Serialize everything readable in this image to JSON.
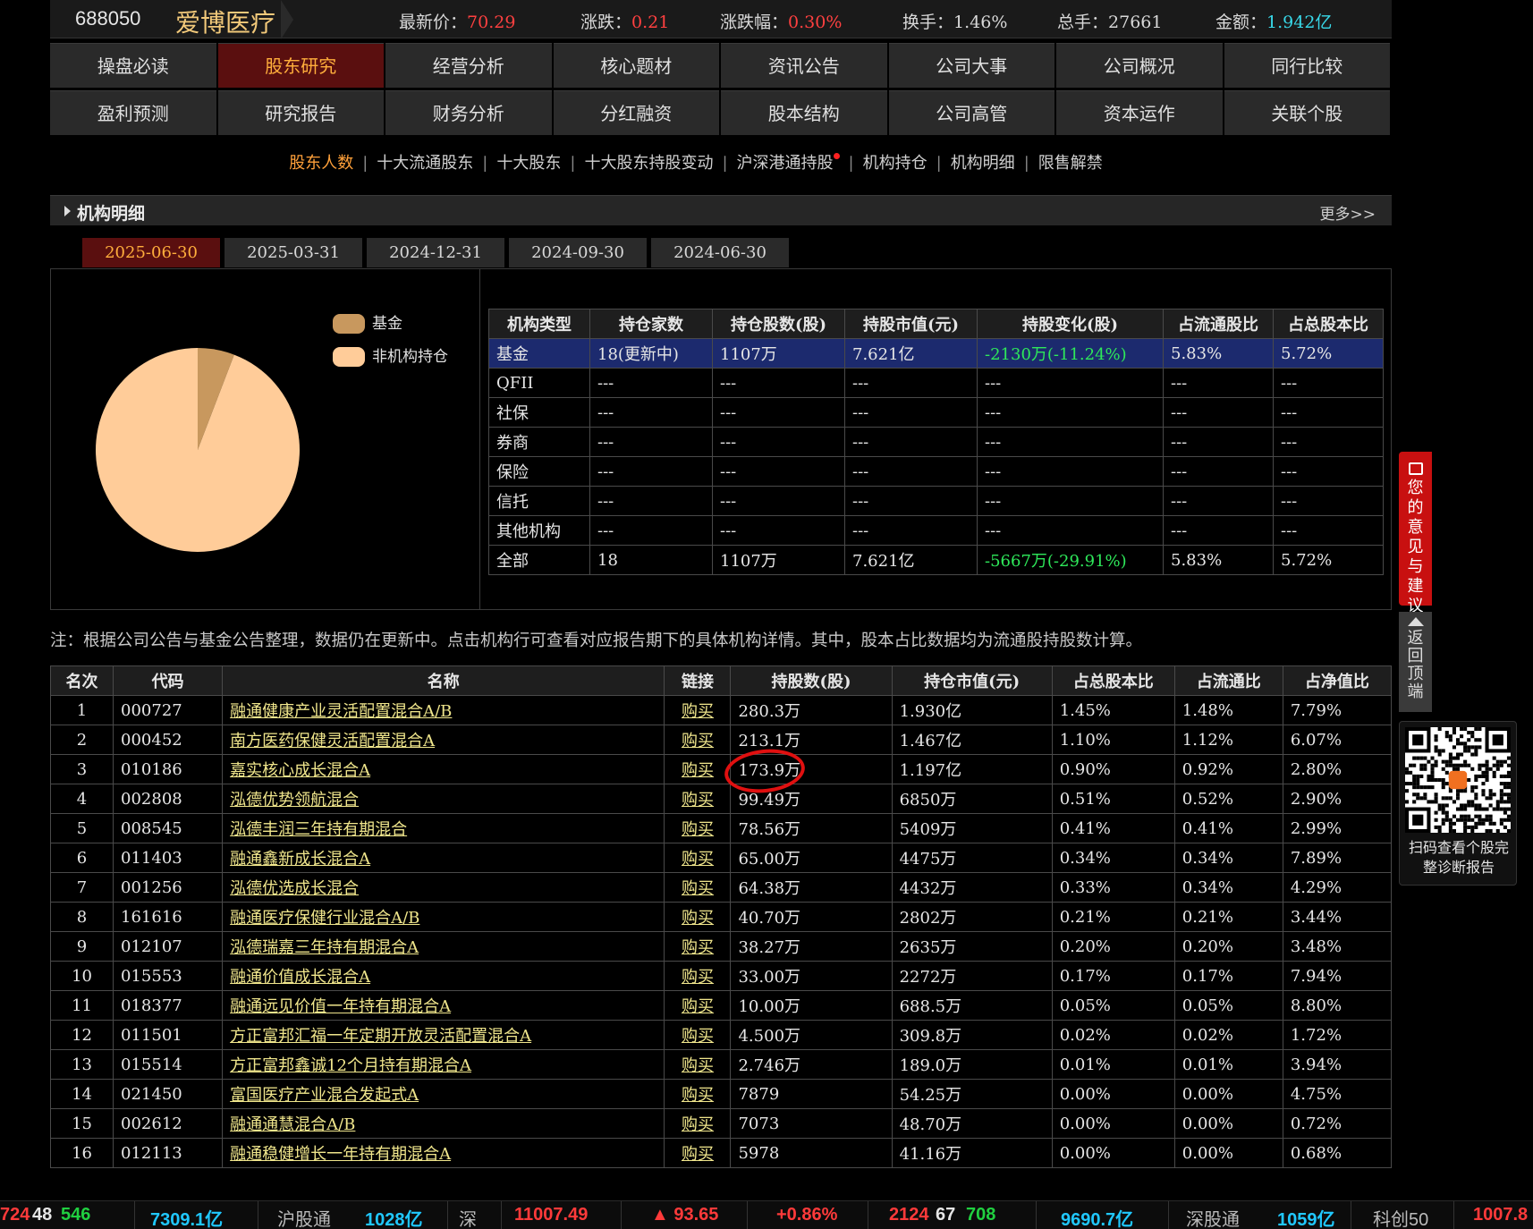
{
  "header": {
    "code": "688050",
    "name": "爱博医疗",
    "stats": [
      {
        "label": "最新价：",
        "value": "70.29",
        "color": "red"
      },
      {
        "label": "涨跌：",
        "value": "0.21",
        "color": "red"
      },
      {
        "label": "涨跌幅：",
        "value": "0.30%",
        "color": "red"
      },
      {
        "label": "换手：",
        "value": "1.46%",
        "color": "plain"
      },
      {
        "label": "总手：",
        "value": "27661",
        "color": "plain"
      },
      {
        "label": "金额：",
        "value": "1.942亿",
        "color": "cyan"
      }
    ]
  },
  "nav": {
    "row1": [
      "操盘必读",
      "股东研究",
      "经营分析",
      "核心题材",
      "资讯公告",
      "公司大事",
      "公司概况",
      "同行比较"
    ],
    "row2": [
      "盈利预测",
      "研究报告",
      "财务分析",
      "分红融资",
      "股本结构",
      "公司高管",
      "资本运作",
      "关联个股"
    ],
    "active": "股东研究"
  },
  "subnav": {
    "items": [
      "股东人数",
      "十大流通股东",
      "十大股东",
      "十大股东持股变动",
      "沪深港通持股",
      "机构持仓",
      "机构明细",
      "限售解禁"
    ],
    "active": "股东人数"
  },
  "section": {
    "title": "机构明细",
    "more": "更多>>"
  },
  "date_tabs": [
    "2025-06-30",
    "2025-03-31",
    "2024-12-31",
    "2024-09-30",
    "2024-06-30"
  ],
  "legend": [
    {
      "label": "基金",
      "color": "#c8985e"
    },
    {
      "label": "非机构持仓",
      "color": "#ffcc99"
    }
  ],
  "chart_data": {
    "type": "pie",
    "labels": [
      "基金",
      "非机构持仓"
    ],
    "values": [
      5.83,
      94.17
    ],
    "colors": [
      "#c8985e",
      "#ffcc99"
    ]
  },
  "summary": {
    "headers": [
      "机构类型",
      "持仓家数",
      "持仓股数(股)",
      "持股市值(元)",
      "持股变化(股)",
      "占流通股比",
      "占总股本比"
    ],
    "rows": [
      [
        "基金",
        "18(更新中)",
        "1107万",
        "7.621亿",
        "-2130万(-11.24%)",
        "5.83%",
        "5.72%"
      ],
      [
        "QFII",
        "---",
        "---",
        "---",
        "---",
        "---",
        "---"
      ],
      [
        "社保",
        "---",
        "---",
        "---",
        "---",
        "---",
        "---"
      ],
      [
        "券商",
        "---",
        "---",
        "---",
        "---",
        "---",
        "---"
      ],
      [
        "保险",
        "---",
        "---",
        "---",
        "---",
        "---",
        "---"
      ],
      [
        "信托",
        "---",
        "---",
        "---",
        "---",
        "---",
        "---"
      ],
      [
        "其他机构",
        "---",
        "---",
        "---",
        "---",
        "---",
        "---"
      ],
      [
        "全部",
        "18",
        "1107万",
        "7.621亿",
        "-5667万(-29.91%)",
        "5.83%",
        "5.72%"
      ]
    ]
  },
  "note": "注：根据公司公告与基金公告整理，数据仍在更新中。点击机构行可查看对应报告期下的具体机构详情。其中，股本占比数据均为流通股持股数计算。",
  "detail": {
    "headers": [
      "名次",
      "代码",
      "名称",
      "链接",
      "持股数(股)",
      "持仓市值(元)",
      "占总股本比",
      "占流通比",
      "占净值比"
    ],
    "buy_label": "购买",
    "rows": [
      [
        "1",
        "000727",
        "融通健康产业灵活配置混合A/B",
        "280.3万",
        "1.930亿",
        "1.45%",
        "1.48%",
        "7.79%"
      ],
      [
        "2",
        "000452",
        "南方医药保健灵活配置混合A",
        "213.1万",
        "1.467亿",
        "1.10%",
        "1.12%",
        "6.07%"
      ],
      [
        "3",
        "010186",
        "嘉实核心成长混合A",
        "173.9万",
        "1.197亿",
        "0.90%",
        "0.92%",
        "2.80%"
      ],
      [
        "4",
        "002808",
        "泓德优势领航混合",
        "99.49万",
        "6850万",
        "0.51%",
        "0.52%",
        "2.90%"
      ],
      [
        "5",
        "008545",
        "泓德丰润三年持有期混合",
        "78.56万",
        "5409万",
        "0.41%",
        "0.41%",
        "2.99%"
      ],
      [
        "6",
        "011403",
        "融通鑫新成长混合A",
        "65.00万",
        "4475万",
        "0.34%",
        "0.34%",
        "7.89%"
      ],
      [
        "7",
        "001256",
        "泓德优选成长混合",
        "64.38万",
        "4432万",
        "0.33%",
        "0.34%",
        "4.29%"
      ],
      [
        "8",
        "161616",
        "融通医疗保健行业混合A/B",
        "40.70万",
        "2802万",
        "0.21%",
        "0.21%",
        "3.44%"
      ],
      [
        "9",
        "012107",
        "泓德瑞嘉三年持有期混合A",
        "38.27万",
        "2635万",
        "0.20%",
        "0.20%",
        "3.48%"
      ],
      [
        "10",
        "015553",
        "融通价值成长混合A",
        "33.00万",
        "2272万",
        "0.17%",
        "0.17%",
        "7.94%"
      ],
      [
        "11",
        "018377",
        "融通远见价值一年持有期混合A",
        "10.00万",
        "688.5万",
        "0.05%",
        "0.05%",
        "8.80%"
      ],
      [
        "12",
        "011501",
        "方正富邦汇福一年定期开放灵活配置混合A",
        "4.500万",
        "309.8万",
        "0.02%",
        "0.02%",
        "1.72%"
      ],
      [
        "13",
        "015514",
        "方正富邦鑫诚12个月持有期混合A",
        "2.746万",
        "189.0万",
        "0.01%",
        "0.01%",
        "3.94%"
      ],
      [
        "14",
        "021450",
        "富国医疗产业混合发起式A",
        "7879",
        "54.25万",
        "0.00%",
        "0.00%",
        "4.75%"
      ],
      [
        "15",
        "002612",
        "融通通慧混合A/B",
        "7073",
        "48.70万",
        "0.00%",
        "0.00%",
        "0.72%"
      ],
      [
        "16",
        "012113",
        "融通稳健增长一年持有期混合A",
        "5978",
        "41.16万",
        "0.00%",
        "0.00%",
        "0.68%"
      ]
    ]
  },
  "side": {
    "feedback": "您的意见与建议",
    "back_top": "返回顶端",
    "qr_text": "扫码查看个股完整诊断报告"
  },
  "ticker": [
    {
      "text": "724",
      "color": "red"
    },
    {
      "text": "48",
      "color": "white"
    },
    {
      "text": "546",
      "color": "green"
    },
    {
      "text": "7309.1亿",
      "color": "cyan"
    },
    {
      "text": "沪股通",
      "color": "grey"
    },
    {
      "text": "1028亿",
      "color": "cyan"
    },
    {
      "text": "深",
      "color": "grey"
    },
    {
      "text": "11007.49",
      "color": "red"
    },
    {
      "text": "▲ 93.65",
      "color": "red"
    },
    {
      "text": "+0.86%",
      "color": "red"
    },
    {
      "text": "2124",
      "color": "red"
    },
    {
      "text": "67",
      "color": "white"
    },
    {
      "text": "708",
      "color": "green"
    },
    {
      "text": "9690.7亿",
      "color": "cyan"
    },
    {
      "text": "深股通",
      "color": "grey"
    },
    {
      "text": "1059亿",
      "color": "cyan"
    },
    {
      "text": "科创50",
      "color": "grey"
    },
    {
      "text": "1007.8",
      "color": "red"
    }
  ]
}
